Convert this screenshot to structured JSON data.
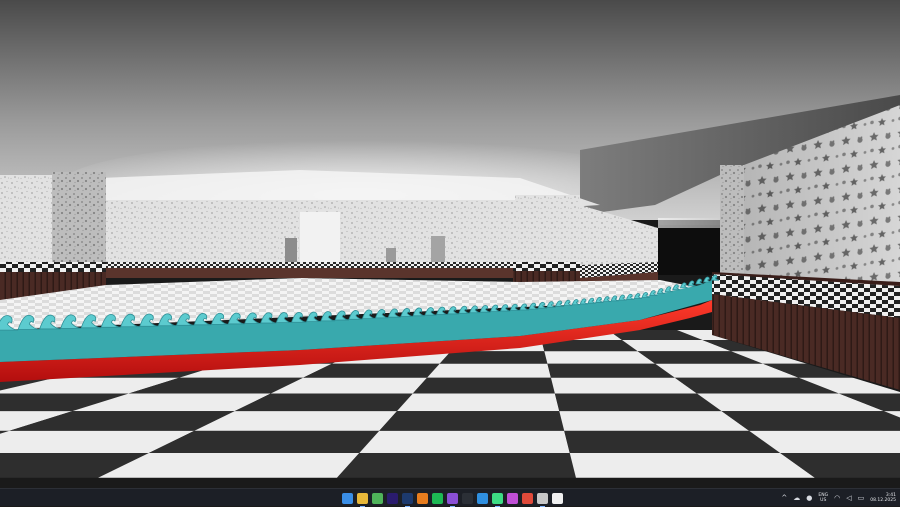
{
  "scene": {
    "description_free": true,
    "floor_colors": {
      "dark": "#2e2e2e",
      "light": "#ededed"
    },
    "wall_pattern_colors": {
      "base": "#d9d9d9",
      "speckle": "#8a8a8a"
    },
    "track_colors": {
      "barrier": "#e41414",
      "wave": "#5ccbcf",
      "wave_shadow": "#2e8f96"
    },
    "ceiling_color": "#6b6b6b"
  },
  "taskbar": {
    "icons": [
      {
        "name": "windows-start-icon",
        "color": "#3a8ee6"
      },
      {
        "name": "file-explorer-icon",
        "color": "#e8b83a"
      },
      {
        "name": "browser-icon",
        "color": "#4fb35a"
      },
      {
        "name": "premiere-icon",
        "color": "#2a1b6e"
      },
      {
        "name": "photoshop-icon",
        "color": "#1d3a6e"
      },
      {
        "name": "blender-icon",
        "color": "#e87d1e"
      },
      {
        "name": "spotify-icon",
        "color": "#1db954"
      },
      {
        "name": "app-circle-icon",
        "color": "#8a4fd6"
      },
      {
        "name": "github-icon",
        "color": "#2b2f36"
      },
      {
        "name": "vscode-icon",
        "color": "#2f8fe0"
      },
      {
        "name": "android-studio-icon",
        "color": "#3ddc84"
      },
      {
        "name": "app-purple-icon",
        "color": "#c04fd6"
      },
      {
        "name": "chrome-icon",
        "color": "#e04a3a"
      },
      {
        "name": "app-grid-icon",
        "color": "#c7c7c7"
      },
      {
        "name": "unreal-engine-icon",
        "color": "#f0f0f0"
      }
    ],
    "tray": {
      "chevron": "^",
      "lang_line1": "ENG",
      "lang_line2": "US",
      "time": "3:41",
      "date": "08.12.2025"
    }
  }
}
